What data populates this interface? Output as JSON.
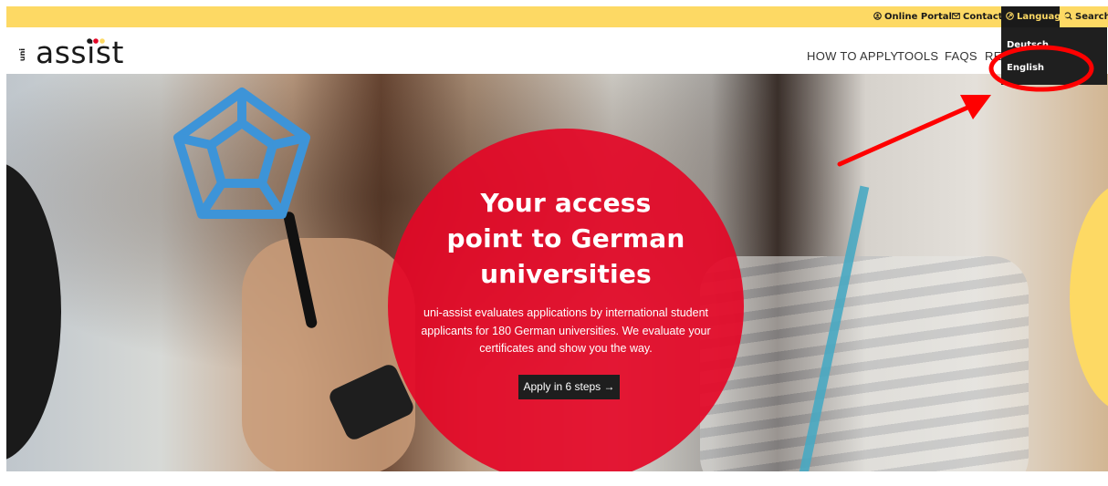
{
  "topbar": {
    "online_portal": "Online Portal",
    "contact": "Contact",
    "language": "Language",
    "search": "Search"
  },
  "logo": {
    "prefix": "uni",
    "name": "assist"
  },
  "nav": {
    "items": [
      "HOW TO APPLY",
      "TOOLS",
      "FAQS",
      "RE"
    ]
  },
  "language_dropdown": {
    "options": [
      "Deutsch",
      "English"
    ],
    "selected": "English"
  },
  "hero": {
    "headline": [
      "Your access",
      "point to German",
      "universities"
    ],
    "subtext": [
      "uni-assist evaluates applications by international student",
      "applicants for 180 German universities. We evaluate your",
      "certificates and show you the way."
    ],
    "cta_label": "Apply in 6 steps →"
  },
  "colors": {
    "topbar_yellow": "#fdd964",
    "brand_red": "#e40626",
    "dark": "#1a1a1a",
    "annotation_red": "#ff0000",
    "logo_dot_red": "#e40626",
    "logo_dot_yellow": "#fdd964",
    "logo_dot_dark": "#1a1a1a"
  },
  "icons": {
    "online_portal": "user-circle-icon",
    "contact": "envelope-icon",
    "language": "globe-icon",
    "search": "search-icon",
    "cta_arrow": "arrow-right-icon"
  }
}
